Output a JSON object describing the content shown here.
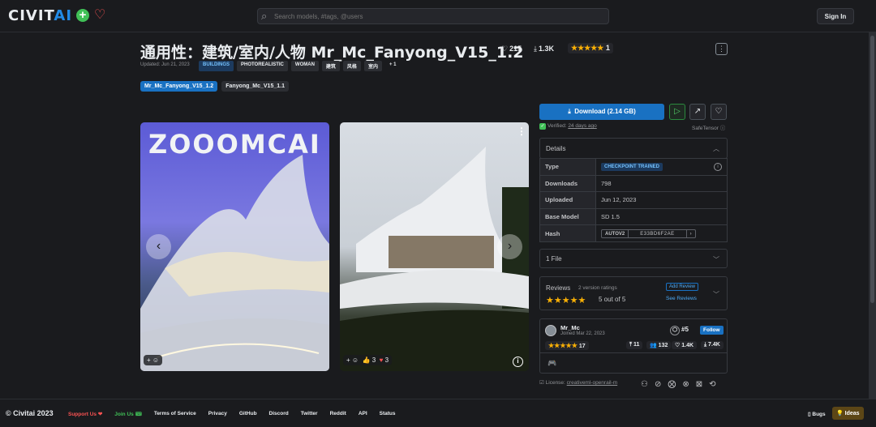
{
  "header": {
    "logo_civit": "CIVIT",
    "logo_ai": "AI",
    "search_placeholder": "Search models, #tags, @users",
    "sign_in": "Sign In"
  },
  "model": {
    "title": "通用性：建筑/室内/人物 Mr_Mc_Fanyong_V15_1.2",
    "likes": "215",
    "downloads": "1.3K",
    "rating_stars": "★★★★★",
    "rating_count": "1",
    "updated": "Updated: Jun 21, 2023",
    "tags": [
      "BUILDINGS",
      "PHOTOREALISTIC",
      "WOMAN",
      "建筑",
      "风格",
      "室内",
      "+ 1"
    ],
    "versions": [
      "Mr_Mc_Fanyong_V15_1.2",
      "Fanyong_Mc_V15_1.1"
    ]
  },
  "gallery": {
    "image1_text": "ZOOOMCAI",
    "image2_likes": "3",
    "image2_hearts": "3"
  },
  "download": {
    "label": "Download (2.14 GB)",
    "verified_prefix": "Verified:",
    "verified_when": "24 days ago",
    "safetensor": "SafeTensor"
  },
  "details": {
    "heading": "Details",
    "rows": [
      {
        "k": "Type",
        "v": "CHECKPOINT TRAINED"
      },
      {
        "k": "Downloads",
        "v": "798"
      },
      {
        "k": "Uploaded",
        "v": "Jun 12, 2023"
      },
      {
        "k": "Base Model",
        "v": "SD 1.5"
      },
      {
        "k": "Hash",
        "v": ""
      }
    ],
    "hash_type": "AUTOV2",
    "hash_value": "E33BD6F2AE"
  },
  "files": {
    "label": "1 File"
  },
  "reviews": {
    "label": "Reviews",
    "count": "2 version ratings",
    "stars": "★★★★★",
    "out_of": "5 out of 5",
    "add": "Add Review",
    "see": "See Reviews"
  },
  "creator": {
    "name": "Mr_Mc",
    "joined": "Joined Mar 22, 2023",
    "rank": "#5",
    "follow": "Follow",
    "stars": "★★★★★",
    "rating_count": "17",
    "uploads": "11",
    "followers": "132",
    "likes": "1.4K",
    "downloads": "7.4K"
  },
  "license": {
    "prefix": "License:",
    "name": "creativeml-openrail-m"
  },
  "footer": {
    "copyright": "© Civitai 2023",
    "links": [
      "Support Us ❤",
      "Join Us 🎟",
      "Terms of Service",
      "Privacy",
      "GitHub",
      "Discord",
      "Twitter",
      "Reddit",
      "API",
      "Status"
    ],
    "bugs": "Bugs",
    "ideas": "Ideas"
  },
  "colors": {
    "accent": "#1971c2",
    "star": "#fab005",
    "success": "#40c057",
    "danger": "#fa5252"
  }
}
